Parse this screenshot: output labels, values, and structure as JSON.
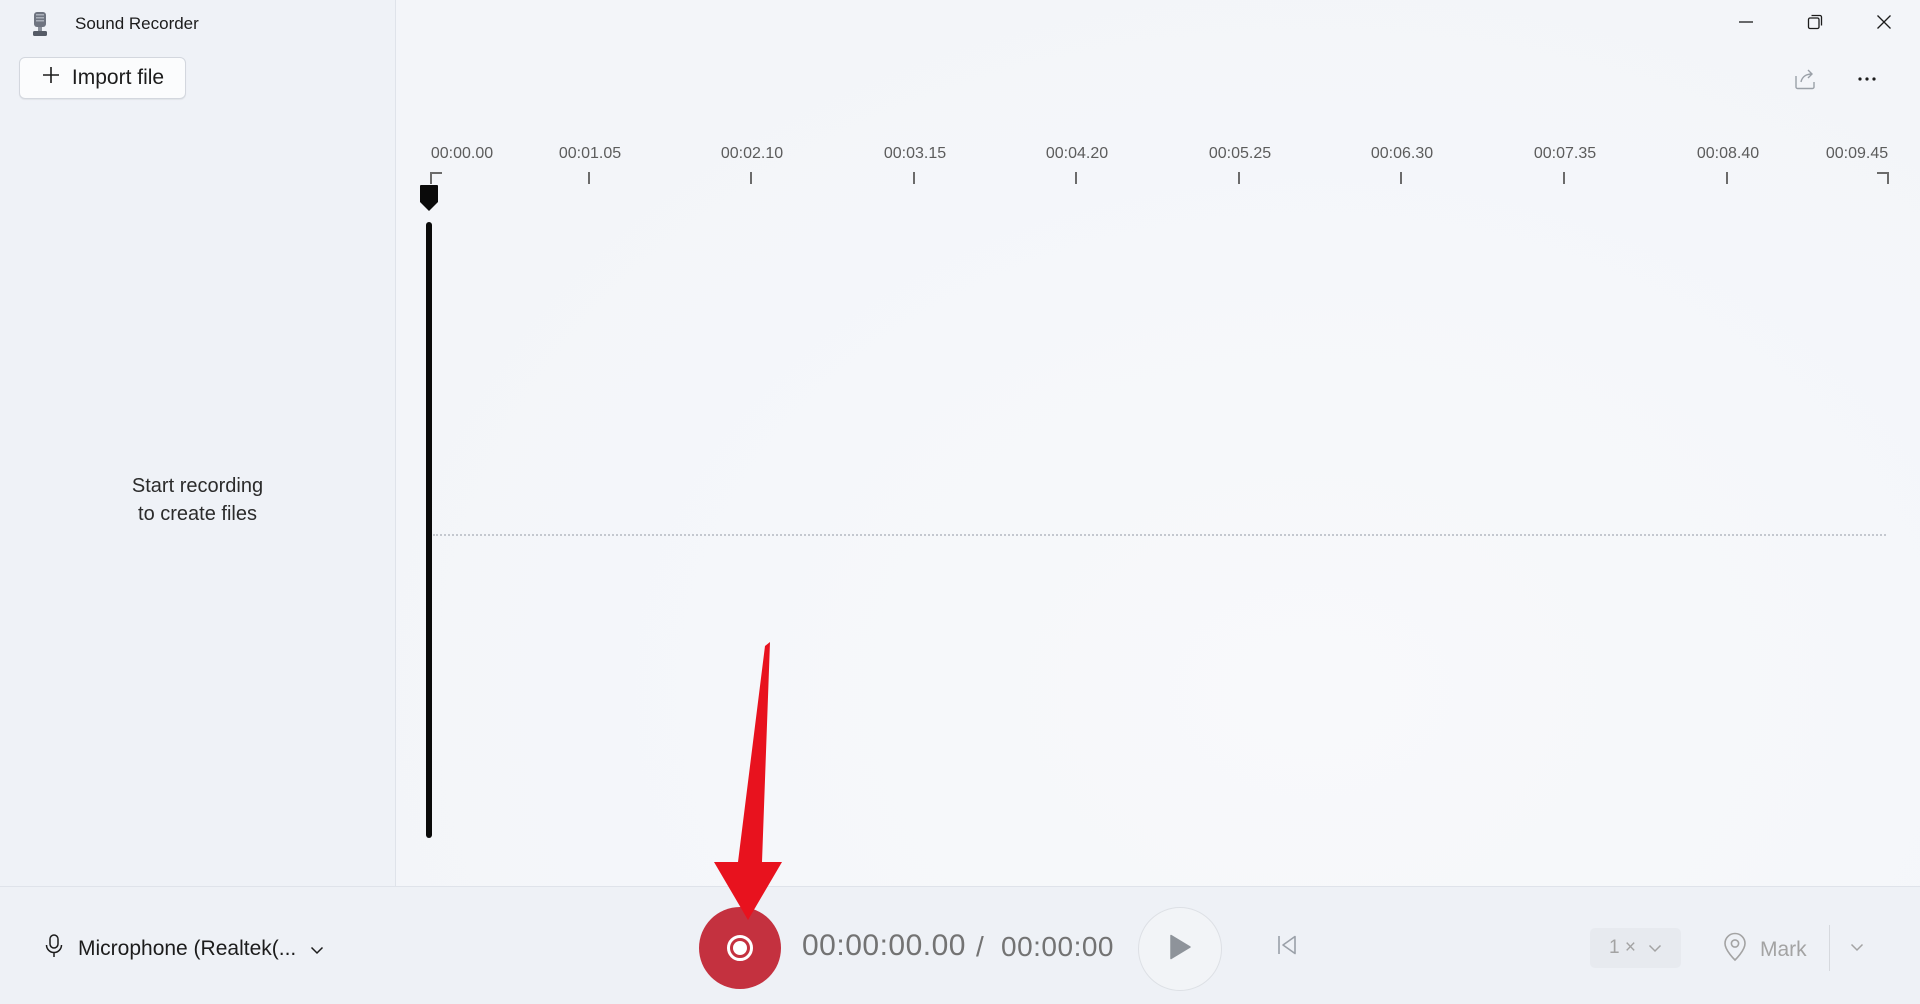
{
  "app": {
    "title": "Sound Recorder"
  },
  "sidebar": {
    "import_label": "Import file",
    "empty_line1": "Start recording",
    "empty_line2": "to create files"
  },
  "timeline": {
    "ticks": [
      "00:00.00",
      "00:01.05",
      "00:02.10",
      "00:03.15",
      "00:04.20",
      "00:05.25",
      "00:06.30",
      "00:07.35",
      "00:08.40",
      "00:09.45"
    ]
  },
  "controls": {
    "microphone": "Microphone (Realtek(...",
    "current_time": "00:00:00.00",
    "separator": "/",
    "total_time": "00:00:00",
    "speed": "1 ×",
    "mark_label": "Mark"
  },
  "icons": {
    "app": "microphone-app-icon",
    "import": "plus-icon",
    "share": "share-icon",
    "more": "more-icon",
    "minimize": "minimize-icon",
    "maximize": "restore-icon",
    "close": "close-icon",
    "mic": "mic-icon",
    "record": "record-icon",
    "play": "play-icon",
    "skip_back": "skip-back-icon",
    "mark": "location-pin-icon",
    "chevron": "chevron-down-icon"
  },
  "colors": {
    "record": "#c4313f",
    "annotation_arrow": "#e8121e",
    "background": "#f3f5f9"
  }
}
